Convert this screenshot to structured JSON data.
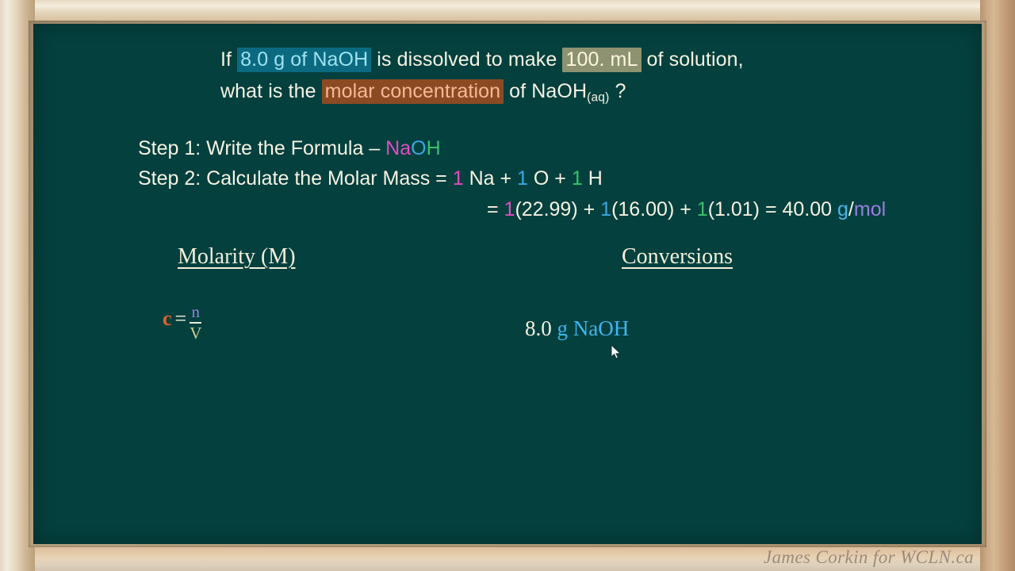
{
  "slide": {
    "board_color": "#04403e",
    "frame_color": "#cbb28e",
    "question": {
      "line1_part1": "If ",
      "line1_highlight_given": "8.0 g of NaOH",
      "line1_part2": " is dissolved to make ",
      "line1_highlight_volume": "100. mL",
      "line1_part3": " of solution,",
      "line2_part1": "what is the ",
      "line2_highlight_find": "molar concentration",
      "line2_part2": " of NaOH",
      "line2_subscript": "(aq)",
      "line2_part3": " ?"
    },
    "step1": {
      "label": "Step 1: Write the Formula – ",
      "formula_na": "Na",
      "formula_o": "O",
      "formula_h": "H"
    },
    "step2": {
      "label": "Step 2: Calculate the Molar Mass = ",
      "coeff_na": "1",
      "element_na": " Na",
      "plus1": " + ",
      "coeff_o": "1",
      "element_o": " O",
      "plus2": " + ",
      "coeff_h": "1",
      "element_h": " H"
    },
    "molar_mass_calc": {
      "equals": "= ",
      "coeff_na": "1",
      "mass_na": "(22.99)",
      "plus1": " + ",
      "coeff_o": "1",
      "mass_o": "(16.00)",
      "plus2": " + ",
      "coeff_h": "1",
      "mass_h": "(1.01)",
      "result_equals": " = 40.00 ",
      "unit_g": "g",
      "unit_slash": "/",
      "unit_mol": "mol"
    },
    "molarity_section": {
      "heading": "Molarity (M)",
      "symbol_c": "c",
      "equals": "=",
      "numerator": "n",
      "denominator": "V"
    },
    "conversions_section": {
      "heading": "Conversions",
      "value": "8.0",
      "unit": "g NaOH"
    },
    "watermark": "James Corkin  for WCLN.ca"
  }
}
